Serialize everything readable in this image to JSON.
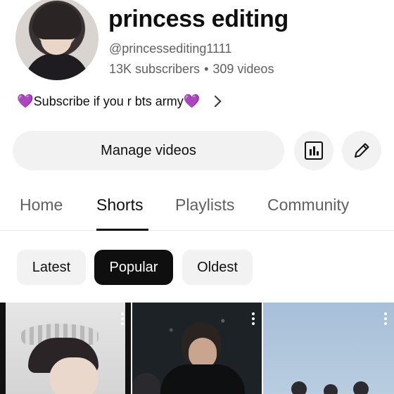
{
  "channel": {
    "name": "princess editing",
    "handle": "@princessediting1111",
    "subscribers": "13K subscribers",
    "separator": "•",
    "videos": "309 videos",
    "description": "Subscribe if you r bts army",
    "description_emoji": "💜"
  },
  "actions": {
    "manage_videos": "Manage videos",
    "analytics_icon": "analytics-icon",
    "edit_icon": "pencil-icon"
  },
  "tabs": [
    {
      "label": "Home",
      "active": false
    },
    {
      "label": "Shorts",
      "active": true
    },
    {
      "label": "Playlists",
      "active": false
    },
    {
      "label": "Community",
      "active": false
    }
  ],
  "filters": [
    {
      "label": "Latest",
      "active": false
    },
    {
      "label": "Popular",
      "active": true
    },
    {
      "label": "Oldest",
      "active": false
    }
  ],
  "colors": {
    "accent": "#0f0f0f",
    "secondary_text": "#606060",
    "chip_bg": "#f2f2f2",
    "heart": "#7b2fbf"
  }
}
